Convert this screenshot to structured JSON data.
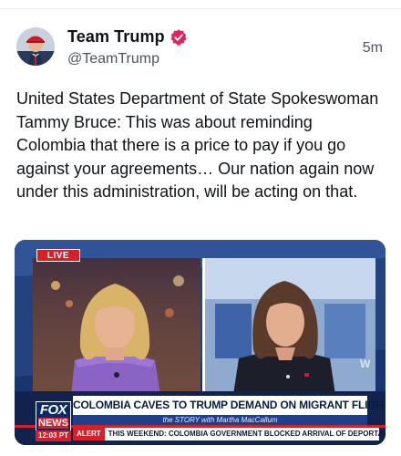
{
  "post": {
    "display_name": "Team Trump",
    "handle": "@TeamTrump",
    "timestamp": "5m",
    "text": "United States Department of State Spokeswoman Tammy Bruce: This was about reminding Colombia that there is a price to pay if you go against your agreements… Our nation again now under this administration, will be acting on that."
  },
  "media": {
    "live_label": "LIVE",
    "network_logo": "FOX",
    "network_logo_sub": "NEWS",
    "time": "12:03 PT",
    "headline": "COLOMBIA CAVES TO TRUMP DEMAND ON MIGRANT FLIGHTS",
    "show_line": "the STORY with Martha MacCallum",
    "alert_label": "ALERT",
    "alert_text": "THIS WEEKEND: COLOMBIA GOVERNMENT BLOCKED ARRIVAL OF DEPORTATION",
    "watermark": "W"
  },
  "colors": {
    "verified": "#e0245e",
    "fox_red": "#d61f26",
    "fox_blue": "#0b2a6b"
  },
  "icons": {
    "verified": "verified-badge-icon"
  }
}
